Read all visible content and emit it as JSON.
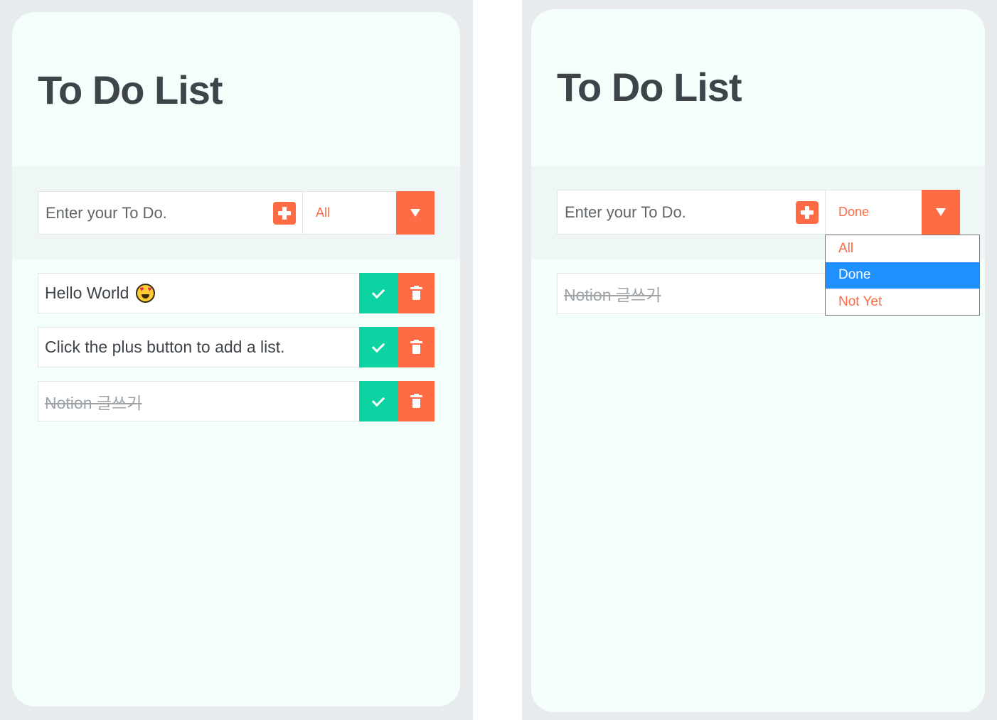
{
  "left_panel": {
    "title": "To Do List",
    "input": {
      "placeholder": "Enter your To Do.",
      "value": ""
    },
    "add_icon": "plus-icon",
    "filter": {
      "selected": "All"
    },
    "todos": [
      {
        "text": "Hello World",
        "done": false,
        "emoji": "star-struck-emoji"
      },
      {
        "text": "Click the plus button to add a list.",
        "done": false
      },
      {
        "text": "Notion 글쓰기",
        "done": true
      }
    ]
  },
  "right_panel": {
    "title": "To Do List",
    "input": {
      "placeholder": "Enter your To Do.",
      "value": ""
    },
    "add_icon": "plus-icon",
    "filter": {
      "selected": "Done",
      "options": [
        "All",
        "Done",
        "Not Yet"
      ],
      "highlighted": "Done"
    },
    "todos": [
      {
        "text": "Notion 글쓰기",
        "done": true
      }
    ]
  },
  "colors": {
    "accent": "#ff6b45",
    "check": "#0dd3a3",
    "card_bg": "#f4fffc",
    "title_text": "#3e4449",
    "dropdown_highlight": "#1e90ff"
  }
}
